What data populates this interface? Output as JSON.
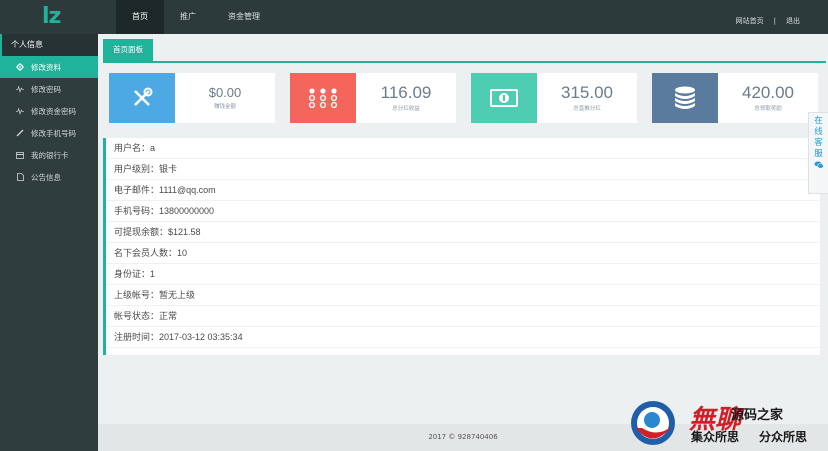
{
  "logo": "lz",
  "topnav": [
    {
      "label": "首页",
      "active": true
    },
    {
      "label": "推广",
      "active": false
    },
    {
      "label": "资金管理",
      "active": false
    }
  ],
  "topright": {
    "home": "网站首页",
    "separator": "|",
    "logout": "退出"
  },
  "sidebar": {
    "header": "个人信息",
    "items": [
      {
        "label": "修改资料",
        "icon": "gear-icon",
        "active": true
      },
      {
        "label": "修改密码",
        "icon": "pulse-icon",
        "active": false
      },
      {
        "label": "修改资金密码",
        "icon": "pulse-icon",
        "active": false
      },
      {
        "label": "修改手机号码",
        "icon": "pencil-icon",
        "active": false
      },
      {
        "label": "我的银行卡",
        "icon": "card-icon",
        "active": false
      },
      {
        "label": "公告信息",
        "icon": "document-icon",
        "active": false
      }
    ]
  },
  "tab": "首页面板",
  "cards": [
    {
      "value": "$0.00",
      "label": "赚钱金额",
      "icon": "wrench-screwdriver-icon",
      "color": "#4ca9e4"
    },
    {
      "value": "116.09",
      "label": "总分红收益",
      "icon": "dots-grid-icon",
      "color": "#f4665c"
    },
    {
      "value": "315.00",
      "label": "总直推分红",
      "icon": "banknote-icon",
      "color": "#4ecdb2"
    },
    {
      "value": "420.00",
      "label": "总领取奖励",
      "icon": "coins-stack-icon",
      "color": "#5a7a9e"
    }
  ],
  "info_rows": [
    "用户名：a",
    "用户级别：银卡",
    "电子邮件：1111@qq.com",
    "手机号码：13800000000",
    "可提现余额：$121.58",
    "名下会员人数：10",
    "身份证：1",
    "上级帐号：暂无上级",
    "帐号状态：正常",
    "注册时间：2017-03-12 03:35:34"
  ],
  "footer": "2017 ©  928740406",
  "kefu": [
    "在",
    "线",
    "客",
    "服"
  ],
  "watermark": {
    "a": "無聊",
    "b": "源码之家",
    "c": "集众所思",
    "d": "分众所思"
  },
  "colors": {
    "accent": "#1fb39a",
    "topbar": "#2c3a3b",
    "sidebar": "#2f3d3e"
  }
}
